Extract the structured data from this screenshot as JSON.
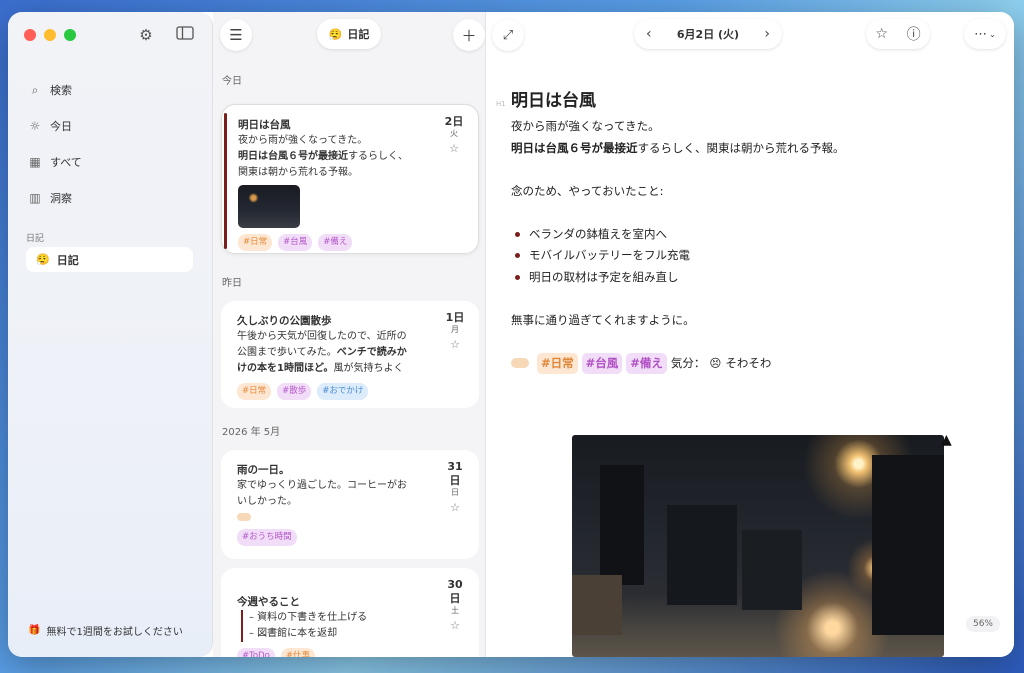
{
  "sidebar": {
    "nav": [
      {
        "icon": "search-icon",
        "glyph": "⌕",
        "label": "検索"
      },
      {
        "icon": "sun-icon",
        "glyph": "☼",
        "label": "今日"
      },
      {
        "icon": "grid-icon",
        "glyph": "▦",
        "label": "すべて"
      },
      {
        "icon": "bar-chart-icon",
        "glyph": "▥",
        "label": "洞察"
      }
    ],
    "section_label": "日記",
    "diary_emoji": "😮‍💨",
    "diary_label": "日記",
    "trial_text": "無料で1週間をお試しください"
  },
  "list": {
    "title_emoji": "😮‍💨",
    "title": "日記",
    "groups": [
      {
        "label": "今日"
      },
      {
        "label": "昨日"
      },
      {
        "label": "2026 年 5月"
      }
    ],
    "entries": [
      {
        "title": "明日は台風",
        "line1": "夜から雨が強くなってきた。",
        "line2a": "明日は台風６号が最接近",
        "line2b": "するらしく、",
        "line3": "関東は朝から荒れる予報。",
        "day": "2日",
        "weekday": "火",
        "tags": [
          "#日常",
          "#台風",
          "#備え"
        ]
      },
      {
        "title": "久しぶりの公園散歩",
        "line1": "午後から天気が回復したので、近所の",
        "line2a": "公園まで歩いてみた。",
        "line2b": "ベンチで読みか",
        "line3a": "けの本を1時間ほど。",
        "line3b": "風が気持ちよく",
        "day": "1日",
        "weekday": "月",
        "tags": [
          "#日常",
          "#散歩",
          "#おでかけ"
        ]
      },
      {
        "title": "雨の一日。",
        "line1": "家でゆっくり過ごした。コーヒーがお",
        "line2": "いしかった。",
        "day": "31日",
        "weekday": "日",
        "tags": [
          "#おうち時間"
        ]
      },
      {
        "title": "今週やること",
        "check1": "– 資料の下書きを仕上げる",
        "check2": "– 図書館に本を返却",
        "day": "30日",
        "weekday": "土",
        "tags": [
          "#ToDo",
          "#仕事"
        ]
      }
    ]
  },
  "detail": {
    "date": "6月2日 (火)",
    "title": "明日は台風",
    "heading_marker": "H1",
    "p1": "夜から雨が強くなってきた。",
    "p2_bold": "明日は台風６号が最接近",
    "p2_rest": "するらしく、関東は朝から荒れる予報。",
    "p3": "念のため、やっておいたこと:",
    "bullets": [
      "ベランダの鉢植えを室内へ",
      "モバイルバッテリーをフル充電",
      "明日の取材は予定を組み直し"
    ],
    "p4": "無事に通り過ぎてくれますように。",
    "tags": [
      "#日常",
      "#台風",
      "#備え"
    ],
    "mood_label": "気分：",
    "mood_emoji": "😣",
    "mood_text": "そわそわ",
    "zoom": "56%"
  }
}
